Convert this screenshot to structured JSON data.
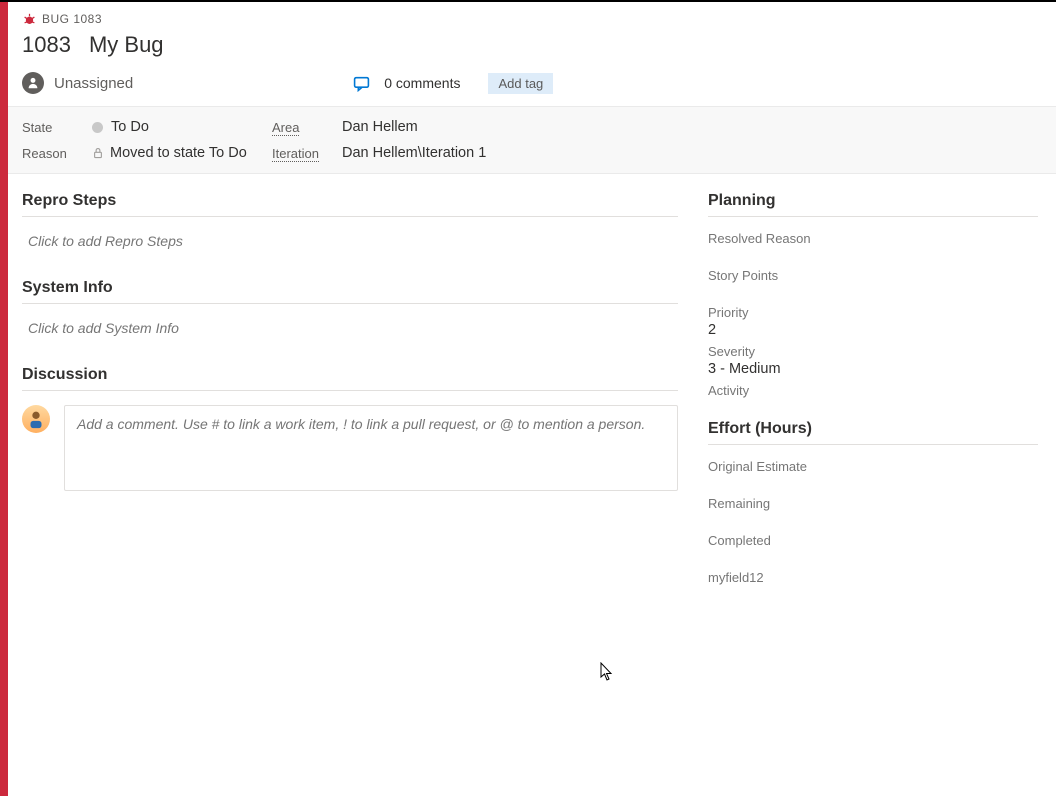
{
  "header": {
    "type_label": "BUG 1083",
    "id": "1083",
    "title": "My Bug",
    "assignee": "Unassigned",
    "comments": "0 comments",
    "add_tag": "Add tag"
  },
  "classification": {
    "state_label": "State",
    "state_value": "To Do",
    "area_label": "Area",
    "area_value": "Dan Hellem",
    "reason_label": "Reason",
    "reason_value": "Moved to state To Do",
    "iteration_label": "Iteration",
    "iteration_value": "Dan Hellem\\Iteration 1"
  },
  "sections": {
    "repro_steps": {
      "title": "Repro Steps",
      "placeholder": "Click to add Repro Steps"
    },
    "system_info": {
      "title": "System Info",
      "placeholder": "Click to add System Info"
    },
    "discussion": {
      "title": "Discussion",
      "placeholder": "Add a comment. Use # to link a work item, ! to link a pull request, or @ to mention a person."
    }
  },
  "planning": {
    "title": "Planning",
    "resolved_reason": {
      "label": "Resolved Reason",
      "value": ""
    },
    "story_points": {
      "label": "Story Points",
      "value": ""
    },
    "priority": {
      "label": "Priority",
      "value": "2"
    },
    "severity": {
      "label": "Severity",
      "value": "3 - Medium"
    },
    "activity": {
      "label": "Activity",
      "value": ""
    }
  },
  "effort": {
    "title": "Effort (Hours)",
    "original_estimate": {
      "label": "Original Estimate",
      "value": ""
    },
    "remaining": {
      "label": "Remaining",
      "value": ""
    },
    "completed": {
      "label": "Completed",
      "value": ""
    },
    "myfield12": {
      "label": "myfield12",
      "value": ""
    }
  }
}
